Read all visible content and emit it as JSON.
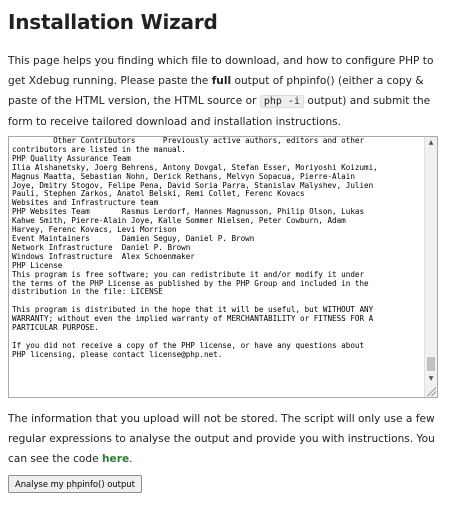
{
  "page": {
    "title": "Installation Wizard",
    "intro": {
      "part1": "This page helps you finding which file to download, and how to configure PHP to get Xdebug running. Please paste the ",
      "bold": "full",
      "part2": " output of phpinfo() (either a copy & paste of the HTML version, the HTML source or ",
      "code": "php -i",
      "part3": " output) and submit the form to receive tailored download and installation instructions."
    },
    "phpinfo_textarea": {
      "value": "         Other Contributors      Previously active authors, editors and other\ncontributors are listed in the manual.\nPHP Quality Assurance Team\nIlia Alshanetsky, Joerg Behrens, Antony Dovgal, Stefan Esser, Moriyoshi Koizumi,\nMagnus Maatta, Sebastian Nohn, Derick Rethans, Melvyn Sopacua, Pierre-Alain\nJoye, Dmitry Stogov, Felipe Pena, David Soria Parra, Stanislav Malyshev, Julien\nPauli, Stephen Zarkos, Anatol Belski, Remi Collet, Ferenc Kovacs\nWebsites and Infrastructure team\nPHP Websites Team       Rasmus Lerdorf, Hannes Magnusson, Philip Olson, Lukas\nKahwe Smith, Pierre-Alain Joye, Kalle Sommer Nielsen, Peter Cowburn, Adam\nHarvey, Ferenc Kovacs, Levi Morrison\nEvent Maintainers       Damien Seguy, Daniel P. Brown\nNetwork Infrastructure  Daniel P. Brown\nWindows Infrastructure  Alex Schoenmaker\nPHP License\nThis program is free software; you can redistribute it and/or modify it under\nthe terms of the PHP License as published by the PHP Group and included in the\ndistribution in the file: LICENSE\n\nThis program is distributed in the hope that it will be useful, but WITHOUT ANY\nWARRANTY; without even the implied warranty of MERCHANTABILITY or FITNESS FOR A\nPARTICULAR PURPOSE.\n\nIf you did not receive a copy of the PHP license, or have any questions about\nPHP licensing, please contact license@php.net."
    },
    "outro": {
      "text": "The information that you upload will not be stored. The script will only use a few regular expressions to analyse the output and provide you with instructions. You can see the code ",
      "link": "here",
      "end": "."
    },
    "submit_label": "Analyse my phpinfo() output"
  },
  "colors": {
    "link": "#2e7d32",
    "text": "#222222"
  },
  "icons": {
    "scroll_up": "arrow-up-icon",
    "scroll_down": "arrow-down-icon",
    "resize": "resize-grip-icon"
  }
}
